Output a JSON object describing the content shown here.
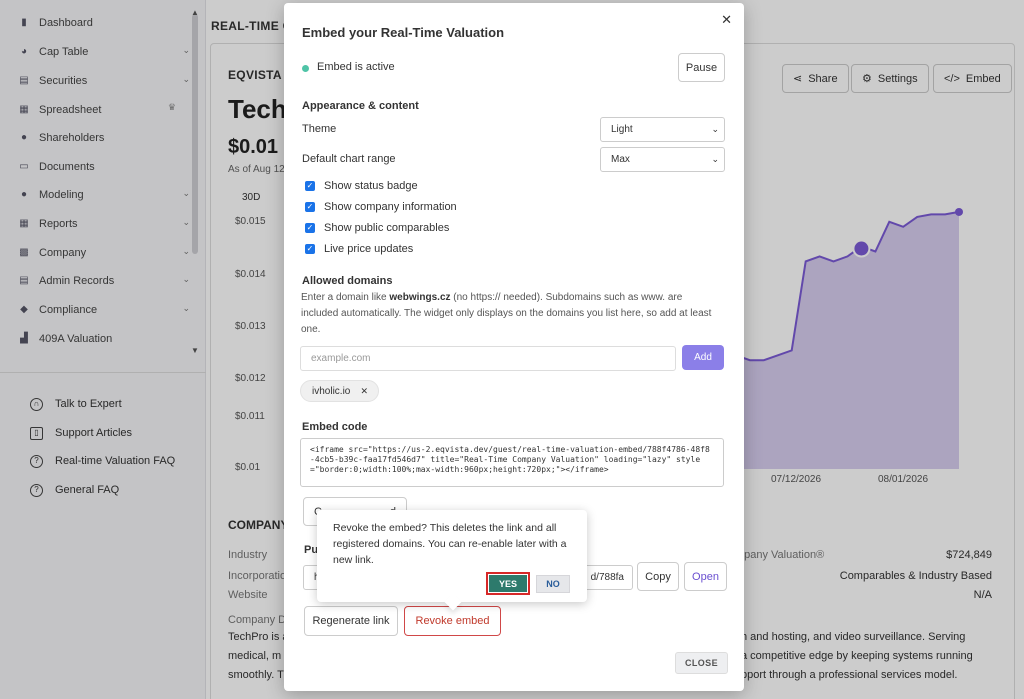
{
  "sidebar": {
    "items": [
      {
        "label": "Dashboard",
        "icon": "dashboard-icon",
        "chevron": false
      },
      {
        "label": "Cap Table",
        "icon": "pie-chart-icon",
        "chevron": true
      },
      {
        "label": "Securities",
        "icon": "securities-icon",
        "chevron": true
      },
      {
        "label": "Spreadsheet",
        "icon": "spreadsheet-icon",
        "chevron": false,
        "badge": "crown-icon"
      },
      {
        "label": "Shareholders",
        "icon": "person-icon",
        "chevron": false
      },
      {
        "label": "Documents",
        "icon": "document-icon",
        "chevron": false
      },
      {
        "label": "Modeling",
        "icon": "bulb-icon",
        "chevron": true
      },
      {
        "label": "Reports",
        "icon": "reports-icon",
        "chevron": true
      },
      {
        "label": "Company",
        "icon": "company-icon",
        "chevron": true
      },
      {
        "label": "Admin Records",
        "icon": "records-icon",
        "chevron": true
      },
      {
        "label": "Compliance",
        "icon": "shield-icon",
        "chevron": true
      },
      {
        "label": "409A Valuation",
        "icon": "valuation-icon",
        "chevron": false
      }
    ],
    "help": [
      {
        "label": "Talk to Expert",
        "icon": "headset-icon"
      },
      {
        "label": "Support Articles",
        "icon": "book-icon"
      },
      {
        "label": "Real-time Valuation FAQ",
        "icon": "help-circle-icon"
      },
      {
        "label": "General FAQ",
        "icon": "help-circle-icon"
      }
    ]
  },
  "main": {
    "title": "REAL-TIME C",
    "card_header": "EQVISTA F",
    "company": "Tech",
    "price": "$0.01",
    "as_of": "As of Aug 12",
    "range": "30D",
    "buttons": {
      "share": "Share",
      "settings": "Settings",
      "embed": "Embed"
    },
    "company_section": "COMPANY",
    "info_labels": {
      "industry": "Industry",
      "incorporation": "Incorporatio",
      "website": "Website",
      "description": "Company D"
    },
    "right_info": [
      {
        "label": "npany Valuation®",
        "value": "$724,849"
      },
      {
        "label": "",
        "value": "Comparables & Industry Based"
      },
      {
        "label": "",
        "value": "N/A"
      }
    ],
    "desc_lines": [
      {
        "left": "TechPro is a",
        "right": "h and hosting, and video surveillance. Serving"
      },
      {
        "left": "medical, m",
        "right": "a competitive edge by keeping systems running"
      },
      {
        "left": "smoothly. T",
        "right": "pport through a professional services model."
      }
    ]
  },
  "chart_data": {
    "type": "area",
    "y_ticks": [
      "$0.015",
      "$0.014",
      "$0.013",
      "$0.012",
      "$0.011",
      "$0.01"
    ],
    "x_ticks": [
      "07/12/2026",
      "08/01/2026"
    ],
    "x": [
      "07/05/2026",
      "07/06/2026",
      "07/07/2026",
      "07/08/2026",
      "07/09/2026",
      "07/10/2026",
      "07/11/2026",
      "07/12/2026",
      "07/13/2026",
      "07/14/2026",
      "07/15/2026",
      "07/16/2026",
      "07/17/2026",
      "07/18/2026",
      "07/19/2026",
      "07/20/2026",
      "07/21/2026",
      "07/22/2026",
      "07/23/2026",
      "07/24/2026",
      "07/25/2026",
      "07/26/2026",
      "07/27/2026",
      "07/28/2026",
      "07/29/2026",
      "07/30/2026",
      "07/31/2026",
      "08/01/2026",
      "08/02/2026",
      "08/03/2026",
      "08/04/2026",
      "08/05/2026",
      "08/06/2026",
      "08/07/2026"
    ],
    "values": [
      0.0122,
      0.0121,
      0.0122,
      0.0121,
      0.0122,
      0.0121,
      0.0122,
      0.0121,
      0.0122,
      0.0121,
      0.0121,
      0.0122,
      0.0121,
      0.0122,
      0.0121,
      0.012,
      0.0121,
      0.0122,
      0.0121,
      0.0121,
      0.0122,
      0.0123,
      0.0141,
      0.0142,
      0.0141,
      0.0142,
      0.0144,
      0.0143,
      0.0149,
      0.0148,
      0.015,
      0.01505,
      0.01505,
      0.0151
    ],
    "ylim": [
      0.0099,
      0.0152
    ],
    "color": "#7b5bd6",
    "fill": "#c9bdea"
  },
  "modal": {
    "title": "Embed your Real-Time Valuation",
    "status": "Embed is active",
    "status_color": "#4fc4a7",
    "pause": "Pause",
    "appearance_title": "Appearance & content",
    "theme_label": "Theme",
    "theme_value": "Light",
    "range_label": "Default chart range",
    "range_value": "Max",
    "checkboxes": [
      {
        "label": "Show status badge",
        "checked": true
      },
      {
        "label": "Show company information",
        "checked": true
      },
      {
        "label": "Show public comparables",
        "checked": true
      },
      {
        "label": "Live price updates",
        "checked": true
      }
    ],
    "domains_title": "Allowed domains",
    "domains_help_1": "Enter a domain like ",
    "domains_help_example": "webwings.cz",
    "domains_help_2": " (no https:// needed). Subdomains such as www. are included automatically. The widget only displays on the domains you list here, so add at least one.",
    "domain_placeholder": "example.com",
    "add": "Add",
    "domain_chip": "ivholic.io",
    "code_title": "Embed code",
    "code": "<iframe src=\"https://us-2.eqvista.dev/guest/real-time-valuation-embed/788f4786-48f8-4cb5-b39c-faa17fd546d7\" title=\"Real-Time Company Valuation\" loading=\"lazy\" style=\"border:0;width:100%;max-width:960px;height:720px;\"></iframe>",
    "copy_code_partial": "C",
    "copy_code_partial_end": "d",
    "public_label": "Pu",
    "url_start": "h",
    "url_end": "d/788fa",
    "copy": "Copy",
    "open": "Open",
    "regenerate": "Regenerate link",
    "revoke": "Revoke embed",
    "close": "CLOSE"
  },
  "popconfirm": {
    "message": "Revoke the embed? This deletes the link and all registered domains. You can re-enable later with a new link.",
    "yes": "YES",
    "no": "NO"
  }
}
